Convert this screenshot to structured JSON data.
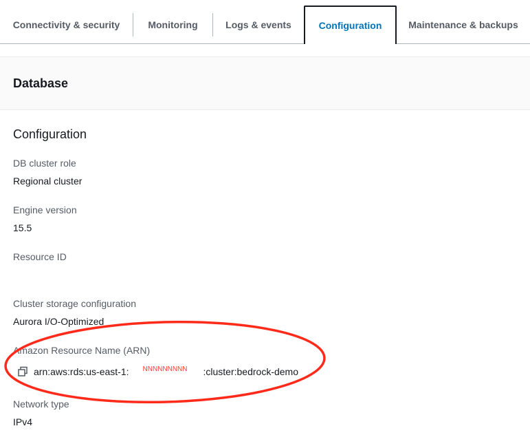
{
  "tabs": [
    {
      "label": "Connectivity & security",
      "active": false
    },
    {
      "label": "Monitoring",
      "active": false
    },
    {
      "label": "Logs & events",
      "active": false
    },
    {
      "label": "Configuration",
      "active": true
    },
    {
      "label": "Maintenance & backups",
      "active": false
    }
  ],
  "card": {
    "title": "Database"
  },
  "section": {
    "title": "Configuration"
  },
  "fields": {
    "db_cluster_role": {
      "label": "DB cluster role",
      "value": "Regional cluster"
    },
    "engine_version": {
      "label": "Engine version",
      "value": "15.5"
    },
    "resource_id": {
      "label": "Resource ID",
      "value": ""
    },
    "cluster_storage": {
      "label": "Cluster storage configuration",
      "value": "Aurora I/O-Optimized"
    },
    "arn": {
      "label": "Amazon Resource Name (ARN)",
      "prefix": "arn:aws:rds:us-east-1:",
      "redacted": "NNNNNNNNN",
      "suffix": ":cluster:bedrock-demo"
    },
    "network_type": {
      "label": "Network type",
      "value": "IPv4"
    }
  },
  "icons": {
    "copy": "copy-icon"
  },
  "colors": {
    "active_tab_text": "#0073bb",
    "annotation_red": "#ff2a1a",
    "label_text": "#545b64",
    "value_text": "#16191f"
  }
}
